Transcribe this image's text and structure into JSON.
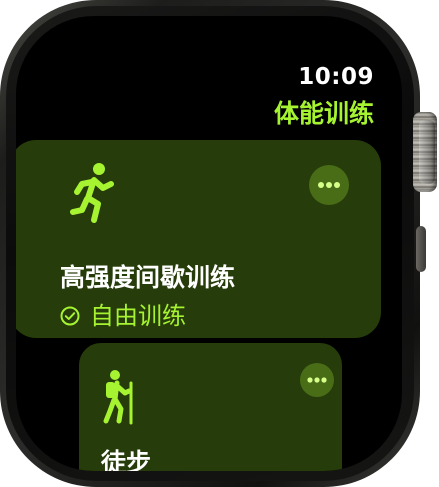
{
  "status_bar": {
    "time": "10:09"
  },
  "app": {
    "title": "体能训练"
  },
  "workouts": [
    {
      "name": "高强度间歇训练",
      "goal": "自由训练",
      "icon": "runner-icon",
      "goal_icon": "checkmark-circle-icon"
    },
    {
      "name": "徒步",
      "icon": "hiker-icon"
    }
  ],
  "colors": {
    "accent": "#a6f431",
    "card": "#263c0a",
    "more_button": "#496d17",
    "screen": "#000000"
  }
}
